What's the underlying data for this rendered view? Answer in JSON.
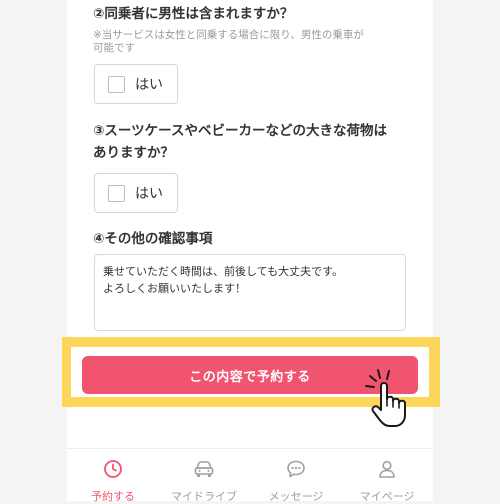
{
  "questions": {
    "q2": {
      "title": "②同乗者に男性は含まれますか？",
      "note": "※当サービスは女性と同乗する場合に限り、男性の乗車が\n可能です",
      "option": "はい",
      "checked": false
    },
    "q3": {
      "title": "③スーツケースやベビーカーなどの大きな荷物は\nありますか？",
      "option": "はい",
      "checked": false
    },
    "q4": {
      "title": "④その他の確認事項",
      "value": "乗せていただく時間は、前後しても大丈夫です。\nよろしくお願いいたします！"
    }
  },
  "submit": {
    "label": "この内容で予約する"
  },
  "tabbar": {
    "items": [
      {
        "label": "予約する",
        "icon": "clock-icon",
        "active": true
      },
      {
        "label": "マイドライブ",
        "icon": "car-icon",
        "active": false
      },
      {
        "label": "メッセージ",
        "icon": "chat-bubble-icon",
        "active": false
      },
      {
        "label": "マイページ",
        "icon": "person-icon",
        "active": false
      }
    ]
  },
  "colors": {
    "accent": "#f0546e",
    "highlight": "#fbd65a",
    "inactive": "#a0a0a0"
  }
}
